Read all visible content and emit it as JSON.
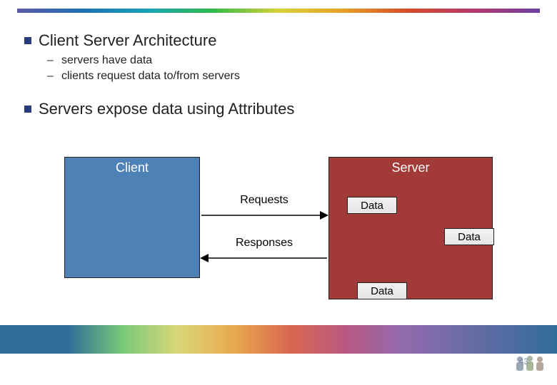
{
  "bullets": {
    "b1": {
      "text": "Client Server Architecture"
    },
    "b1_subs": [
      {
        "text": "servers have data"
      },
      {
        "text": "clients request data to/from servers"
      }
    ],
    "b2": {
      "text": "Servers expose data using Attributes"
    }
  },
  "diagram": {
    "client_label": "Client",
    "server_label": "Server",
    "requests_label": "Requests",
    "responses_label": "Responses",
    "data_label_1": "Data",
    "data_label_2": "Data",
    "data_label_3": "Data"
  },
  "footer": {
    "page_number": "43"
  },
  "colors": {
    "bullet_square": "#2a3d7a",
    "client_box": "#4e81b5",
    "server_box": "#a23a37"
  }
}
